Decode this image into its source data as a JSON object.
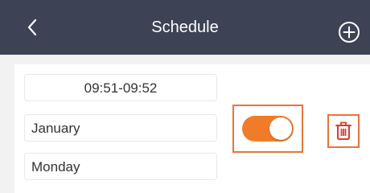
{
  "header": {
    "back_icon": "chevron-left-icon",
    "title": "Schedule",
    "add_icon": "plus-circle-icon",
    "background_color": "#3d4355"
  },
  "schedule_item": {
    "time_range": "09:51-09:52",
    "month": "January",
    "day": "Monday",
    "enabled": true,
    "toggle_color": "#f07c2a",
    "delete_icon": "trash-icon",
    "delete_color": "#e03a2b",
    "highlight_color": "#e8743b"
  }
}
